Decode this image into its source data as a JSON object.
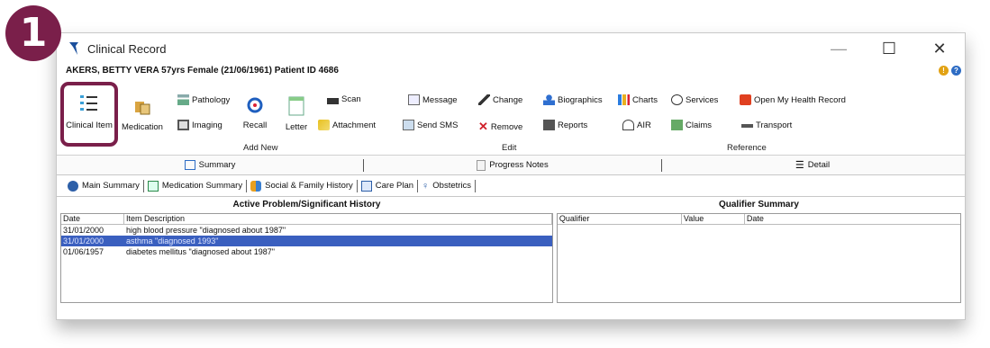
{
  "step_badge": "1",
  "window": {
    "title": "Clinical Record",
    "controls": {
      "minimize": "—",
      "maximize": "☐",
      "close": "✕"
    }
  },
  "patient": "AKERS, BETTY VERA 57yrs Female (21/06/1961) Patient ID 4686",
  "ribbon": {
    "clinical_item": "Clinical Item",
    "medication": "Medication",
    "pathology": "Pathology",
    "imaging": "Imaging",
    "recall": "Recall",
    "letter": "Letter",
    "scan": "Scan",
    "attachment": "Attachment",
    "message": "Message",
    "send_sms": "Send SMS",
    "change": "Change",
    "remove": "Remove",
    "biographics": "Biographics",
    "reports": "Reports",
    "charts": "Charts",
    "air": "AIR",
    "services": "Services",
    "claims": "Claims",
    "open_my_health_record": "Open My Health Record",
    "transport": "Transport",
    "groups": {
      "add_new": "Add New",
      "edit": "Edit",
      "reference": "Reference"
    }
  },
  "views": {
    "summary": "Summary",
    "progress_notes": "Progress Notes",
    "detail": "Detail"
  },
  "tabs": [
    "Main Summary",
    "Medication Summary",
    "Social & Family History",
    "Care Plan",
    "Obstetrics"
  ],
  "active_problems": {
    "title": "Active Problem/Significant History",
    "columns": [
      "Date",
      "Item Description"
    ],
    "rows": [
      {
        "date": "31/01/2000",
        "desc": "high blood pressure \"diagnosed about 1987\""
      },
      {
        "date": "31/01/2000",
        "desc": "asthma \"diagnosed 1993\""
      },
      {
        "date": "01/06/1957",
        "desc": "diabetes mellitus \"diagnosed about 1987\""
      }
    ]
  },
  "qualifier": {
    "title": "Qualifier Summary",
    "columns": [
      "Qualifier",
      "Value",
      "Date"
    ]
  },
  "colors": {
    "highlight": "#7a1f4a",
    "selection": "#3a5fbf"
  }
}
